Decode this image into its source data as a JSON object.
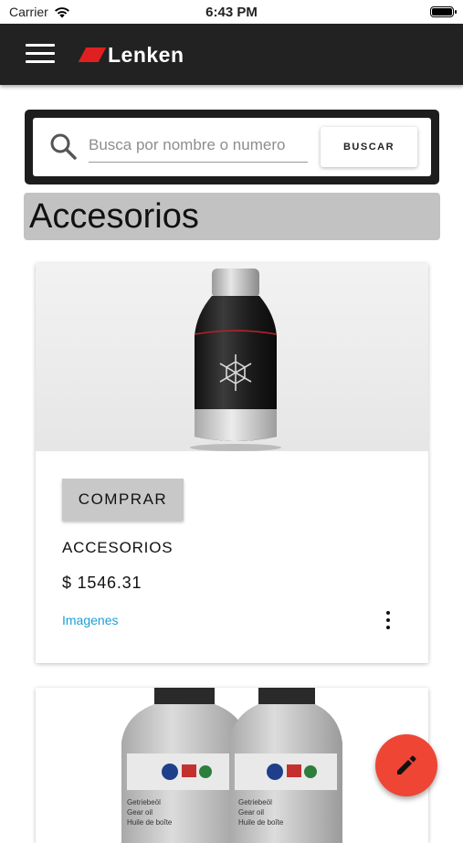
{
  "status_bar": {
    "carrier": "Carrier",
    "time": "6:43 PM",
    "battery_level": 0.95
  },
  "app_bar": {
    "logo_text": "Lenken",
    "menu_icon": "hamburger-menu-icon",
    "brand_color": "#e02020",
    "background_color": "#222222"
  },
  "search": {
    "placeholder": "Busca por nombre o numero",
    "value": "",
    "button_label": "BUSCAR",
    "icon": "search-icon"
  },
  "section": {
    "title": "Accesorios"
  },
  "products": [
    {
      "image": "black-bottle-snowflake",
      "buy_label": "COMPRAR",
      "name": "ACCESORIOS",
      "price": "$ 1546.31",
      "images_link": "Imagenes",
      "more_icon": "more-vertical-icon"
    },
    {
      "image": "gear-oil-bottles",
      "bottle_labels": [
        "Getriebeöl",
        "Gear oil",
        "Huile de boîte"
      ]
    }
  ],
  "fab": {
    "icon": "edit-pencil-icon",
    "color": "#ee4534"
  },
  "colors": {
    "link": "#1a9fd8",
    "section_bg": "#c2c2c2",
    "buy_button_bg": "#c8c8c8"
  }
}
